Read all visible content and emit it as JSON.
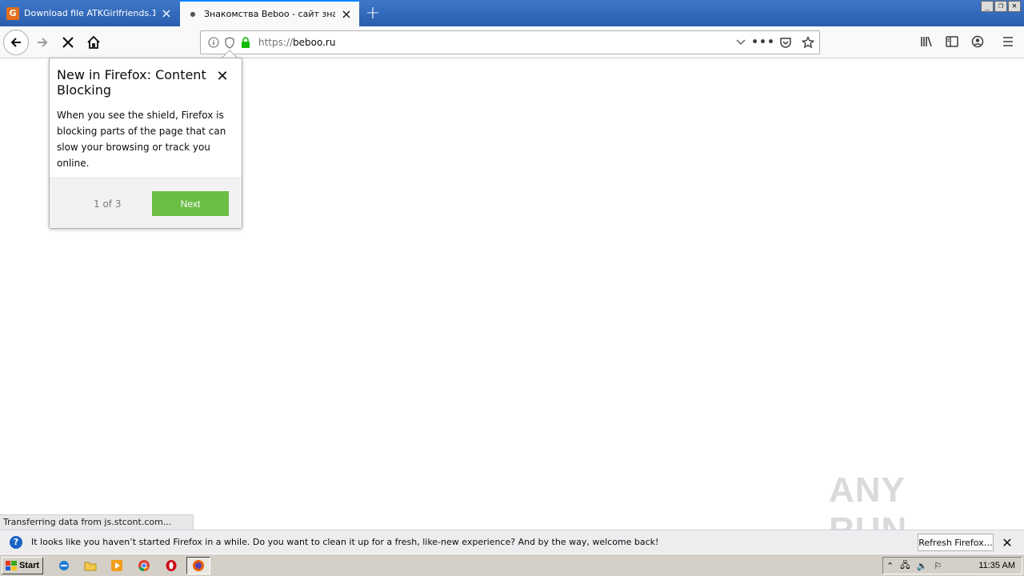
{
  "tabs": [
    {
      "title": "Download file ATKGirlfriends.19.1",
      "favicon": "download-site-favicon"
    },
    {
      "title": "Знакомства Beboo - сайт знаком",
      "favicon": "loading-dot-icon"
    }
  ],
  "window_controls": {
    "minimize": "_",
    "restore": "❐",
    "close": "✕"
  },
  "nav": {
    "url_protocol": "https://",
    "url_host": "beboo.ru"
  },
  "popup": {
    "title": "New in Firefox: Content Blocking",
    "body": "When you see the shield, Firefox is blocking parts of the page that can slow your browsing or track you online.",
    "step": "1 of 3",
    "next_label": "Next",
    "accent_color": "#6cbd45"
  },
  "status_text": "Transferring data from js.stcont.com...",
  "watermark": "ANY RUN",
  "notification": {
    "text": "It looks like you haven’t started Firefox in a while. Do you want to clean it up for a fresh, like-new experience? And by the way, welcome back!",
    "button_label": "Refresh Firefox…"
  },
  "taskbar": {
    "start_label": "Start",
    "clock": "11:35 AM"
  }
}
